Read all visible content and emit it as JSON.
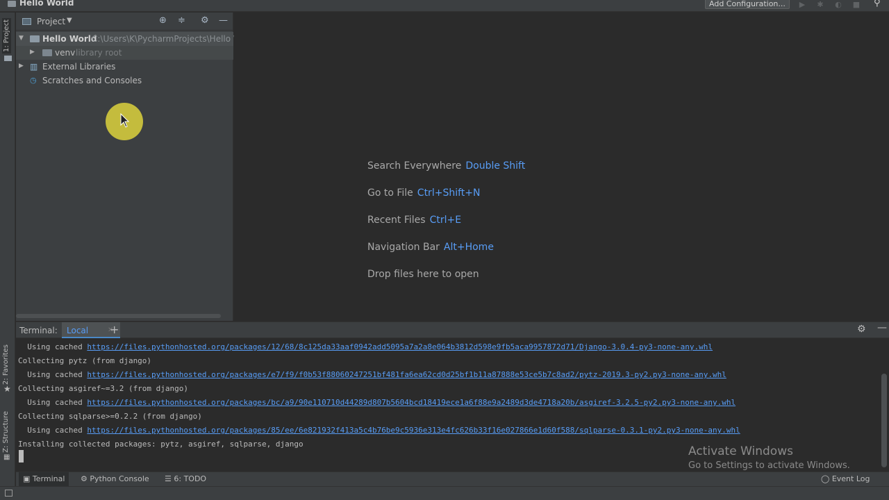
{
  "window": {
    "title": "Hello World",
    "add_config": "Add Configuration..."
  },
  "left_strip": {
    "project_tab": "1: Project",
    "favorites_tab": "2: Favorites",
    "structure_tab": "Z: Structure"
  },
  "project_panel": {
    "header": "Project",
    "tree": [
      {
        "label": "Hello World",
        "detail": "C:\\Users\\K\\PycharmProjects\\Hello Wo"
      },
      {
        "label": "venv",
        "detail": "library root"
      },
      {
        "label": "External Libraries"
      },
      {
        "label": "Scratches and Consoles"
      }
    ]
  },
  "editor_hints": [
    {
      "action": "Search Everywhere",
      "key": "Double Shift"
    },
    {
      "action": "Go to File",
      "key": "Ctrl+Shift+N"
    },
    {
      "action": "Recent Files",
      "key": "Ctrl+E"
    },
    {
      "action": "Navigation Bar",
      "key": "Alt+Home"
    },
    {
      "action": "Drop files here to open",
      "key": ""
    }
  ],
  "terminal": {
    "label": "Terminal:",
    "tab": "Local",
    "lines": [
      {
        "prefix": "  Using cached ",
        "link": "https://files.pythonhosted.org/packages/12/68/8c125da33aaf0942add5095a7a2a8e064b3812d598e9fb5aca9957872d71/Django-3.0.4-py3-none-any.whl"
      },
      {
        "prefix": "Collecting pytz (from django)",
        "link": ""
      },
      {
        "prefix": "  Using cached ",
        "link": "https://files.pythonhosted.org/packages/e7/f9/f0b53f88060247251bf481fa6ea62cd0d25bf1b11a87888e53ce5b7c8ad2/pytz-2019.3-py2.py3-none-any.whl"
      },
      {
        "prefix": "Collecting asgiref~=3.2 (from django)",
        "link": ""
      },
      {
        "prefix": "  Using cached ",
        "link": "https://files.pythonhosted.org/packages/bc/a9/90e110710d44289d807b5604bcd18419ece1a6f88e9a2489d3de4718a20b/asgiref-3.2.5-py2.py3-none-any.whl"
      },
      {
        "prefix": "Collecting sqlparse>=0.2.2 (from django)",
        "link": ""
      },
      {
        "prefix": "  Using cached ",
        "link": "https://files.pythonhosted.org/packages/85/ee/6e821932f413a5c4b76be9c5936e313e4fc626b33f16e027866e1d60f588/sqlparse-0.3.1-py2.py3-none-any.whl"
      },
      {
        "prefix": "Installing collected packages: pytz, asgiref, sqlparse, django",
        "link": ""
      }
    ]
  },
  "watermark": {
    "line1": "Activate Windows",
    "line2": "Go to Settings to activate Windows."
  },
  "bottom_tools": {
    "terminal": "Terminal",
    "python_console": "Python Console",
    "todo": "6: TODO",
    "event_log": "Event Log"
  }
}
